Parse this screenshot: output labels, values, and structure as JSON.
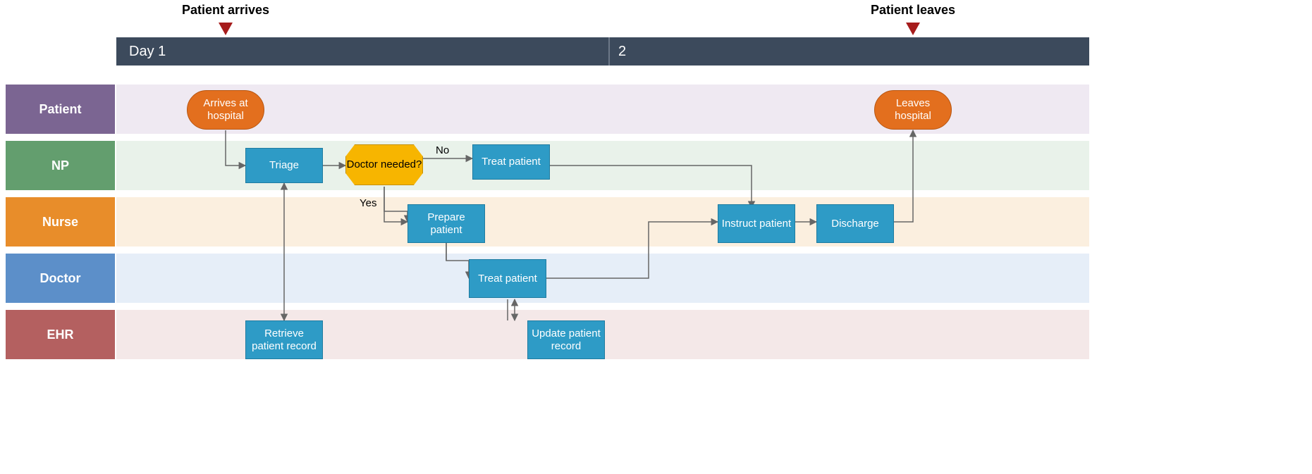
{
  "milestones": {
    "arrive": "Patient arrives",
    "leave": "Patient leaves"
  },
  "timeline": {
    "seg1": "Day 1",
    "seg2": "2"
  },
  "lanes": {
    "patient": "Patient",
    "np": "NP",
    "nurse": "Nurse",
    "doctor": "Doctor",
    "ehr": "EHR"
  },
  "nodes": {
    "arrives": "Arrives at hospital",
    "triage": "Triage",
    "decision": "Doctor needed?",
    "np_treat": "Treat patient",
    "prepare": "Prepare patient",
    "doc_treat": "Treat patient",
    "retrieve": "Retrieve patient record",
    "update": "Update patient record",
    "instruct": "Instruct patient",
    "discharge": "Discharge",
    "leaves": "Leaves hospital"
  },
  "edges": {
    "no": "No",
    "yes": "Yes"
  }
}
